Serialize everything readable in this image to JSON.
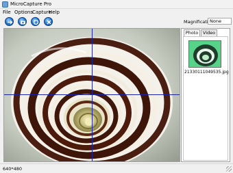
{
  "window": {
    "title": "MicroCapture Pro"
  },
  "menu": [
    "File",
    "Options",
    "Capture",
    "Help"
  ],
  "toolbar": {
    "buttons": [
      {
        "icon": "arrow-right-icon"
      },
      {
        "icon": "camera-icon"
      },
      {
        "icon": "record-icon"
      },
      {
        "icon": "close-icon"
      }
    ]
  },
  "magnification": {
    "label": "Magnification:",
    "value": "None"
  },
  "panel": {
    "tabs": [
      "Photo",
      "Video"
    ],
    "active_tab": "Photo",
    "thumbnail_name": "21330111049535.jpg"
  },
  "status": {
    "resolution": "640*480"
  }
}
